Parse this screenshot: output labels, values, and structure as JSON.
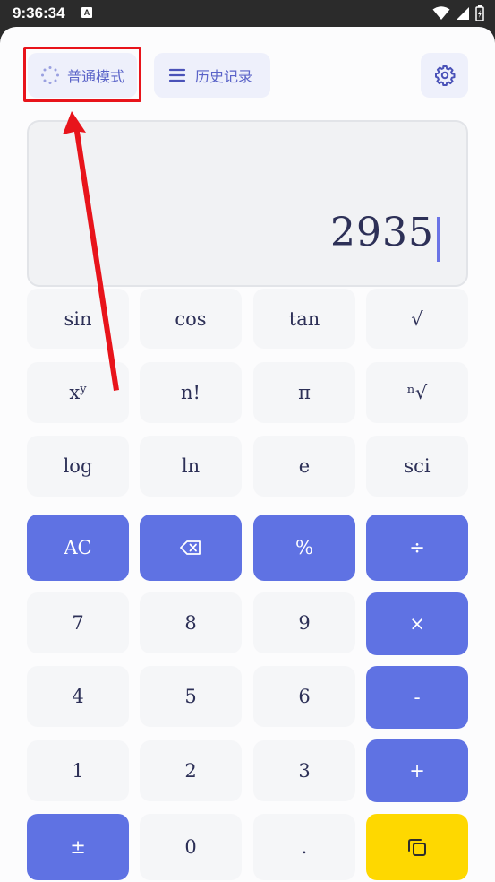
{
  "status_bar": {
    "time": "9:36:34",
    "notification_badge": "A"
  },
  "toolbar": {
    "mode_label": "普通模式",
    "history_label": "历史记录"
  },
  "display": {
    "value": "2935"
  },
  "keypad": {
    "sci_row1": [
      "sin",
      "cos",
      "tan",
      "√"
    ],
    "sci_row2_labels": [
      "n!",
      "π",
      "ⁿ√"
    ],
    "power": {
      "base": "x",
      "exp": "y"
    },
    "sci_row3": [
      "log",
      "ln",
      "e",
      "sci"
    ],
    "ac": "AC",
    "percent": "%",
    "divide": "÷",
    "multiply": "×",
    "minus": "-",
    "plus": "+",
    "plus_minus": "±",
    "zero": "0",
    "dot": ".",
    "digits": [
      "7",
      "8",
      "9",
      "4",
      "5",
      "6",
      "1",
      "2",
      "3"
    ]
  },
  "colors": {
    "accent": "#5f72e3",
    "equals_key": "#fed800",
    "annotation": "#e8141b"
  }
}
